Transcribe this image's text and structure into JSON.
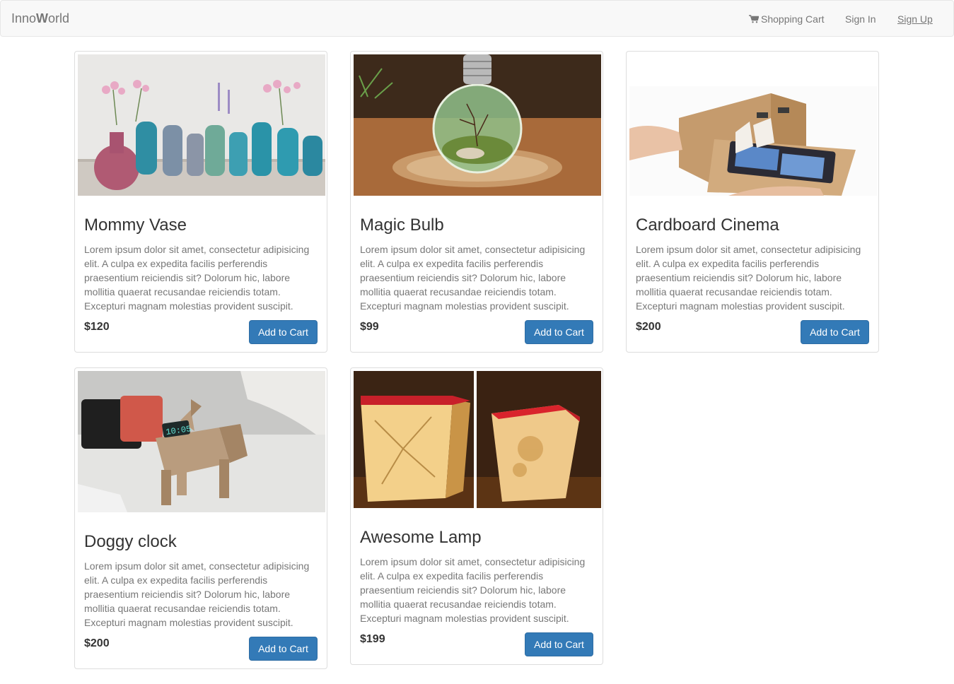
{
  "navbar": {
    "brand_prefix": "Inno",
    "brand_bold": "W",
    "brand_suffix": "orld",
    "links": {
      "cart": "Shopping Cart",
      "sign_in": "Sign In",
      "sign_up": "Sign Up"
    }
  },
  "products": [
    {
      "title": "Mommy Vase",
      "description": "Lorem ipsum dolor sit amet, consectetur adipisicing elit. A culpa ex expedita facilis perferendis praesentium reiciendis sit? Dolorum hic, labore mollitia quaerat recusandae reiciendis totam. Excepturi magnam molestias provident suscipit.",
      "price": "$120",
      "button": "Add to Cart",
      "image": "vases-photo"
    },
    {
      "title": "Magic Bulb",
      "description": "Lorem ipsum dolor sit amet, consectetur adipisicing elit. A culpa ex expedita facilis perferendis praesentium reiciendis sit? Dolorum hic, labore mollitia quaerat recusandae reiciendis totam. Excepturi magnam molestias provident suscipit.",
      "price": "$99",
      "button": "Add to Cart",
      "image": "terrarium-bulb-photo"
    },
    {
      "title": "Cardboard Cinema",
      "description": "Lorem ipsum dolor sit amet, consectetur adipisicing elit. A culpa ex expedita facilis perferendis praesentium reiciendis sit? Dolorum hic, labore mollitia quaerat recusandae reiciendis totam. Excepturi magnam molestias provident suscipit.",
      "price": "$200",
      "button": "Add to Cart",
      "image": "cardboard-viewer-photo"
    },
    {
      "title": "Doggy clock",
      "description": "Lorem ipsum dolor sit amet, consectetur adipisicing elit. A culpa ex expedita facilis perferendis praesentium reiciendis sit? Dolorum hic, labore mollitia quaerat recusandae reiciendis totam. Excepturi magnam molestias provident suscipit.",
      "price": "$200",
      "button": "Add to Cart",
      "image": "cardboard-dog-clock-photo",
      "clock_display": "10:05"
    },
    {
      "title": "Awesome Lamp",
      "description": "Lorem ipsum dolor sit amet, consectetur adipisicing elit. A culpa ex expedita facilis perferendis praesentium reiciendis sit? Dolorum hic, labore mollitia quaerat recusandae reiciendis totam. Excepturi magnam molestias provident suscipit.",
      "price": "$199",
      "button": "Add to Cart",
      "image": "paper-lantern-photo"
    }
  ],
  "colors": {
    "navbar_bg": "#f8f8f8",
    "nav_text": "#777777",
    "button_bg": "#337ab7",
    "title_text": "#333333",
    "body_text": "#777777"
  },
  "icons": {
    "cart": "shopping-cart-icon"
  }
}
